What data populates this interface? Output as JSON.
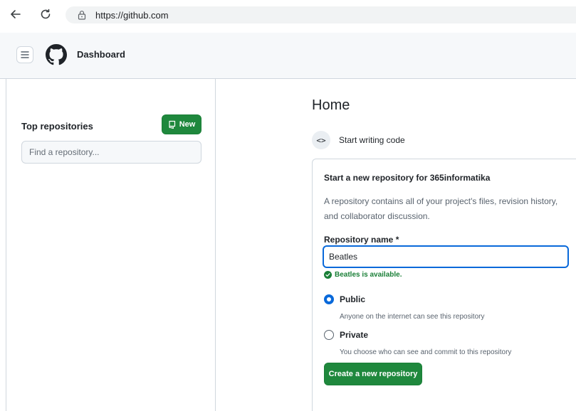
{
  "browser": {
    "url": "https://github.com"
  },
  "header": {
    "title": "Dashboard"
  },
  "sidebar": {
    "title": "Top repositories",
    "new_button_label": "New",
    "find_placeholder": "Find a repository..."
  },
  "main": {
    "title": "Home",
    "start_label": "Start writing code",
    "start_icon": "<>",
    "card": {
      "title": "Start a new repository for 365informatika",
      "description": "A repository contains all of your project's files, revision history, and collaborator discussion.",
      "repo_name_label": "Repository name *",
      "repo_name_value": "Beatles",
      "availability_text": "Beatles is available.",
      "visibility_options": [
        {
          "label": "Public",
          "description": "Anyone on the internet can see this repository",
          "selected": true
        },
        {
          "label": "Private",
          "description": "You choose who can see and commit to this repository",
          "selected": false
        }
      ],
      "create_button_label": "Create a new repository"
    }
  },
  "colors": {
    "primary_green": "#1f883d",
    "accent_blue": "#0969da",
    "success_green": "#1a7f37"
  }
}
